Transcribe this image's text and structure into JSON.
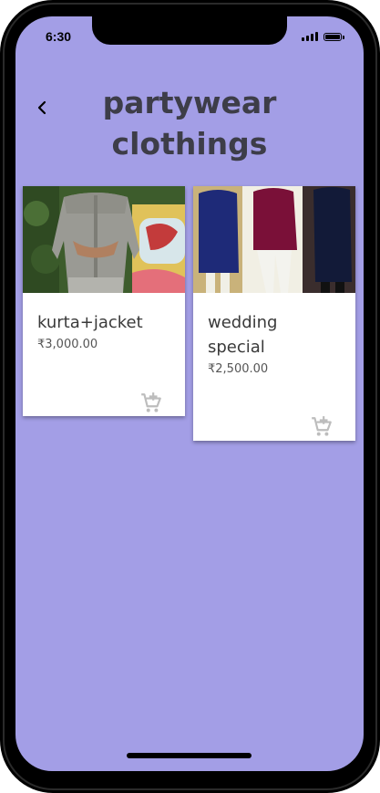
{
  "status_bar": {
    "time": "6:30",
    "signal_icon": "cellular-signal-icon",
    "battery_icon": "battery-full-icon"
  },
  "header": {
    "back_icon": "chevron-left-icon",
    "title": "partywear\nclothings"
  },
  "products": [
    {
      "name": "kurta+jacket",
      "price": "₹3,000.00",
      "cart_icon": "add-to-cart-icon"
    },
    {
      "name": "wedding\nspecial",
      "price": "₹2,500.00",
      "cart_icon": "add-to-cart-icon"
    }
  ],
  "colors": {
    "background": "#a39ee6",
    "title_text": "#3d3d48",
    "card_background": "#ffffff",
    "cart_icon": "#bdbdbd"
  }
}
